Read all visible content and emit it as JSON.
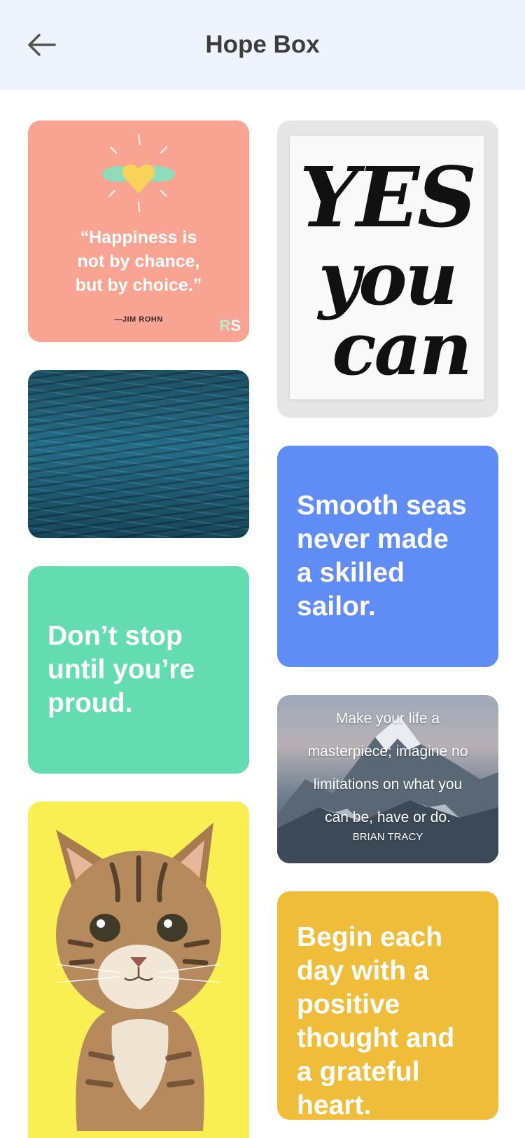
{
  "header": {
    "title": "Hope Box",
    "back_icon": "arrow-left-icon"
  },
  "colors": {
    "header_bg": "#eef3fd",
    "salmon": "#f9a392",
    "blue": "#608cf5",
    "green": "#64dcb1",
    "yellow": "#f0bd3a",
    "kitten_bg": "#f9ef52"
  },
  "cards": {
    "happiness": {
      "quote_line1": "“Happiness is",
      "quote_line2": "not by chance,",
      "quote_line3": "but by choice.”",
      "author": "—JIM ROHN",
      "logo_r": "R",
      "logo_s": "S"
    },
    "yes_you_can": {
      "word1": "YES",
      "word2": "you",
      "word3": "can"
    },
    "smooth_seas": {
      "line1": "Smooth seas",
      "line2": "never made",
      "line3": "a skilled",
      "line4": "sailor."
    },
    "dont_stop": {
      "line1": "Don’t stop",
      "line2": "until you’re",
      "line3": "proud."
    },
    "masterpiece": {
      "line1": "Make your life a",
      "line2": "masterpiece; imagine no",
      "line3": "limitations on what you",
      "line4": "can be, have or do.",
      "author": "BRIAN TRACY"
    },
    "begin_each_day": {
      "line1": "Begin each",
      "line2": "day with a",
      "line3": "positive",
      "line4": "thought and",
      "line5": "a grateful",
      "line6": "heart."
    }
  }
}
